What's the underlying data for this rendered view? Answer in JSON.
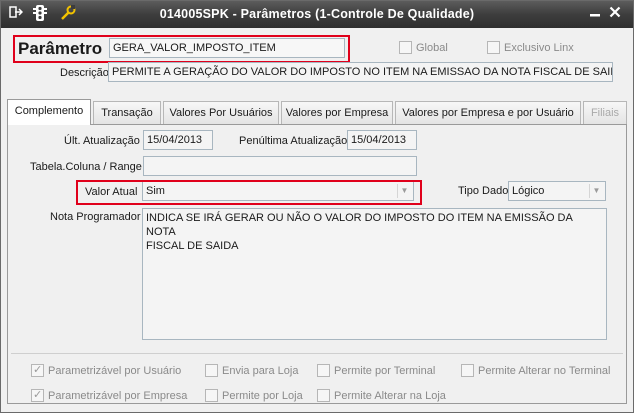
{
  "window": {
    "title": "014005SPK - Parâmetros (1-Controle De Qualidade)",
    "icons": {
      "left1": "exit-icon",
      "left2": "traffic-light-icon",
      "left3": "wrench-icon",
      "minimize": "minimize-icon",
      "close": "close-icon"
    }
  },
  "header": {
    "parametro_label": "Parâmetro",
    "parametro_value": "GERA_VALOR_IMPOSTO_ITEM",
    "global_label": "Global",
    "exclusivo_label": "Exclusivo Linx",
    "descricao_label": "Descrição",
    "descricao_value": "PERMITE A GERAÇÃO DO VALOR DO IMPOSTO NO ITEM NA EMISSAO DA NOTA FISCAL DE SAIDA"
  },
  "tabs": [
    {
      "label": "Complemento"
    },
    {
      "label": "Transação"
    },
    {
      "label": "Valores Por Usuários"
    },
    {
      "label": "Valores por Empresa"
    },
    {
      "label": "Valores por Empresa e por Usuário"
    },
    {
      "label": "Filiais"
    }
  ],
  "complemento": {
    "ult_atualizacao_label": "Últ. Atualização",
    "ult_atualizacao_value": "15/04/2013",
    "penultima_label": "Penúltima Atualização",
    "penultima_value": "15/04/2013",
    "tabela_label": "Tabela.Coluna / Range",
    "tabela_value": "",
    "valor_atual_label": "Valor Atual",
    "valor_atual_value": "Sim",
    "tipo_dado_label": "Tipo Dado",
    "tipo_dado_value": "Lógico",
    "nota_label": "Nota Programador",
    "nota_value": "INDICA SE IRÁ GERAR OU NÃO O VALOR DO IMPOSTO DO ITEM NA EMISSÃO DA NOTA\nFISCAL DE SAIDA"
  },
  "checkboxes": {
    "param_usuario": {
      "label": "Parametrizável por Usuário",
      "checked": true
    },
    "envia_loja": {
      "label": "Envia para Loja",
      "checked": false
    },
    "permite_terminal": {
      "label": "Permite por Terminal",
      "checked": false
    },
    "permite_alterar_terminal": {
      "label": "Permite Alterar no Terminal",
      "checked": false
    },
    "param_empresa": {
      "label": "Parametrizável por Empresa",
      "checked": true
    },
    "permite_loja": {
      "label": "Permite por Loja",
      "checked": false
    },
    "permite_alterar_loja": {
      "label": "Permite Alterar na Loja",
      "checked": false
    }
  },
  "colors": {
    "highlight": "#e0001b",
    "titlebar": "#3d3d3d"
  }
}
